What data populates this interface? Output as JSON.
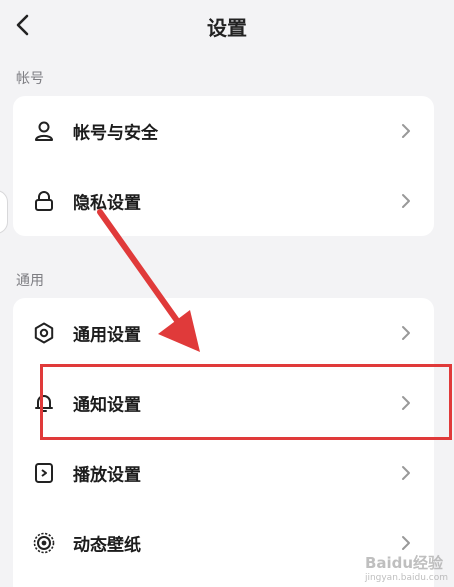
{
  "header": {
    "title": "设置"
  },
  "sections": [
    {
      "label": "帐号",
      "items": [
        {
          "label": "帐号与安全",
          "icon": "person-icon"
        },
        {
          "label": "隐私设置",
          "icon": "lock-icon"
        }
      ]
    },
    {
      "label": "通用",
      "items": [
        {
          "label": "通用设置",
          "icon": "gear-icon"
        },
        {
          "label": "通知设置",
          "icon": "bell-icon"
        },
        {
          "label": "播放设置",
          "icon": "play-icon"
        },
        {
          "label": "动态壁纸",
          "icon": "wallpaper-icon"
        }
      ]
    }
  ],
  "watermark": {
    "text": "Baidu经验",
    "sub": "jingyan.baidu.com"
  },
  "colors": {
    "annotation": "#e03a3a",
    "background": "#f3f3f5",
    "card": "#ffffff"
  }
}
